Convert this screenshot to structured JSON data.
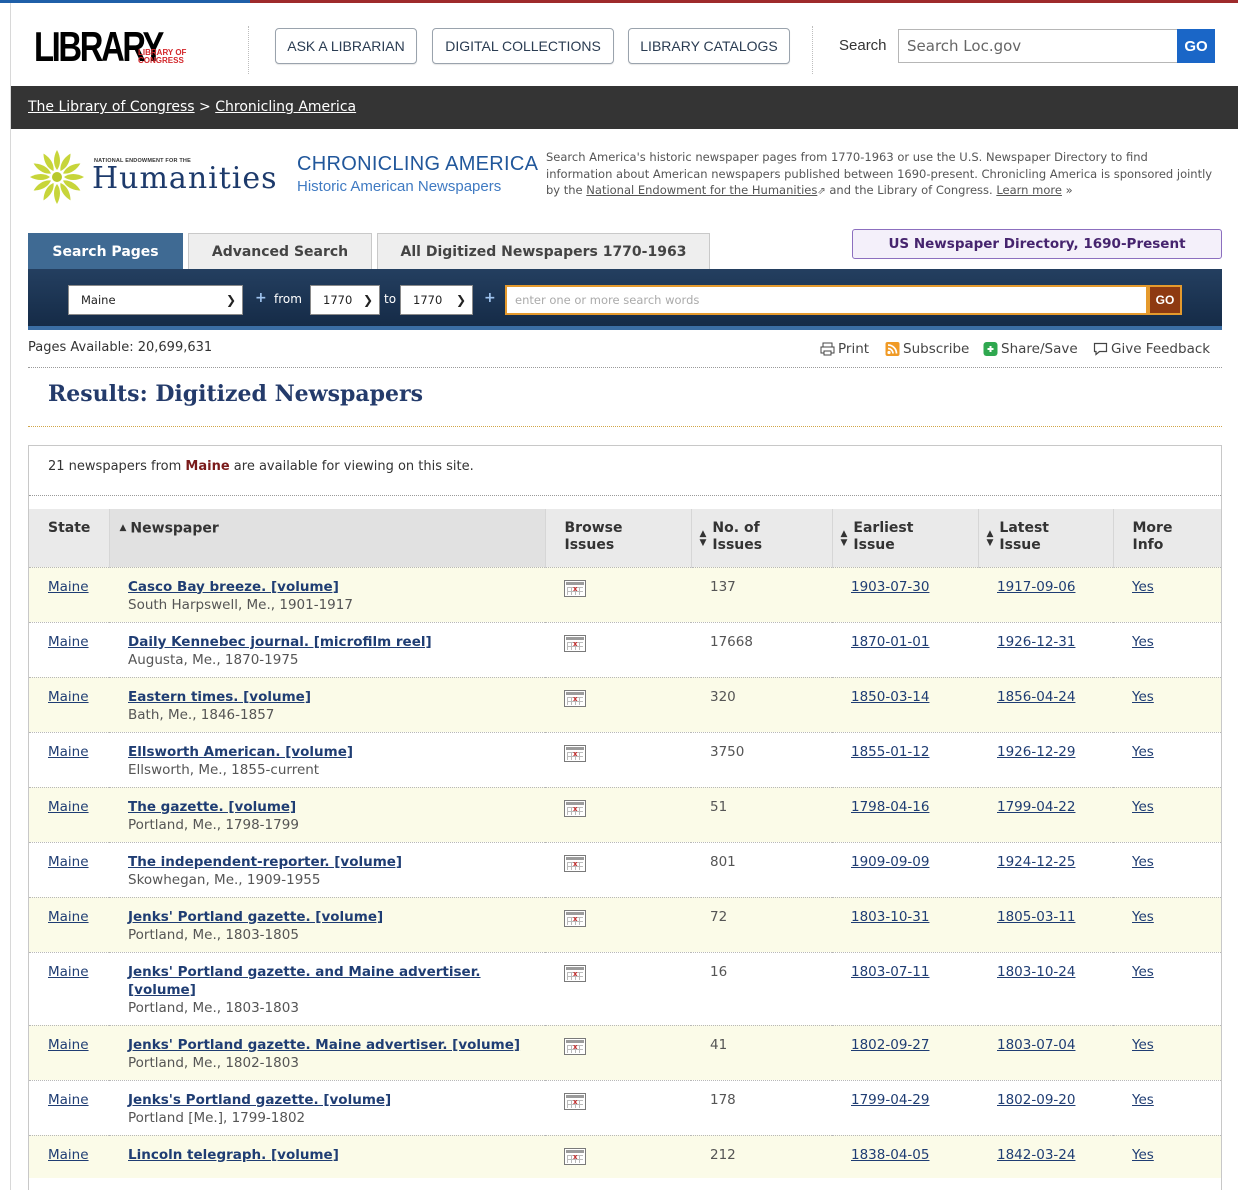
{
  "header": {
    "logo_big": "LIBRARY",
    "logo_small": "LIBRARY OF CONGRESS",
    "buttons": [
      "ASK A LIBRARIAN",
      "DIGITAL COLLECTIONS",
      "LIBRARY CATALOGS"
    ],
    "search_label": "Search",
    "search_placeholder": "Search Loc.gov",
    "go_label": "GO"
  },
  "breadcrumb": {
    "home": "The Library of Congress",
    "separator": ">",
    "current": "Chronicling America"
  },
  "banner": {
    "neh_small": "NATIONAL ENDOWMENT FOR THE",
    "neh_word": "Humanities",
    "title": "CHRONICLING AMERICA",
    "subtitle": "Historic American Newspapers",
    "desc_start": "Search America's historic newspaper pages from 1770-1963 or use the U.S. Newspaper Directory to find information about American newspapers published between 1690-present. Chronicling America is sponsored jointly by the ",
    "desc_link": "National Endowment for the Humanities",
    "desc_mid": " and the Library of Congress. ",
    "desc_more": "Learn more",
    "desc_more_arrow": "»"
  },
  "tabs": [
    {
      "label": "Search Pages",
      "active": true
    },
    {
      "label": "Advanced Search",
      "active": false
    },
    {
      "label": "All Digitized Newspapers 1770-1963",
      "active": false
    }
  ],
  "directory_button": "US Newspaper Directory, 1690-Present",
  "search_bar": {
    "state": "Maine",
    "plus": "+",
    "from_label": "from",
    "from_year": "1770",
    "to_label": "to",
    "to_year": "1770",
    "placeholder": "enter one or more search words",
    "go_label": "GO"
  },
  "meta": {
    "pages_available": "Pages Available: 20,699,631",
    "tools": [
      "Print",
      "Subscribe",
      "Share/Save",
      "Give Feedback"
    ]
  },
  "results": {
    "title": "Results: Digitized Newspapers",
    "count_prefix": "21 newspapers from ",
    "count_state": "Maine",
    "count_suffix": " are available for viewing on this site.",
    "columns": {
      "state": "State",
      "newspaper": "Newspaper",
      "browse_1": "Browse",
      "browse_2": "Issues",
      "num_1": "No. of",
      "num_2": "Issues",
      "earliest_1": "Earliest",
      "earliest_2": "Issue",
      "latest_1": "Latest",
      "latest_2": "Issue",
      "more_1": "More",
      "more_2": "Info"
    },
    "rows": [
      {
        "state": "Maine",
        "title": "Casco Bay breeze. [volume]",
        "place": "South Harpswell, Me., 1901-1917",
        "issues": "137",
        "earliest": "1903-07-30",
        "latest": "1917-09-06",
        "more": "Yes"
      },
      {
        "state": "Maine",
        "title": "Daily Kennebec journal. [microfilm reel]",
        "place": "Augusta, Me., 1870-1975",
        "issues": "17668",
        "earliest": "1870-01-01",
        "latest": "1926-12-31",
        "more": "Yes"
      },
      {
        "state": "Maine",
        "title": "Eastern times. [volume]",
        "place": "Bath, Me., 1846-1857",
        "issues": "320",
        "earliest": "1850-03-14",
        "latest": "1856-04-24",
        "more": "Yes"
      },
      {
        "state": "Maine",
        "title": "Ellsworth American. [volume]",
        "place": "Ellsworth, Me., 1855-current",
        "issues": "3750",
        "earliest": "1855-01-12",
        "latest": "1926-12-29",
        "more": "Yes"
      },
      {
        "state": "Maine",
        "title": "The gazette. [volume]",
        "place": "Portland, Me., 1798-1799",
        "issues": "51",
        "earliest": "1798-04-16",
        "latest": "1799-04-22",
        "more": "Yes"
      },
      {
        "state": "Maine",
        "title": "The independent-reporter. [volume]",
        "place": "Skowhegan, Me., 1909-1955",
        "issues": "801",
        "earliest": "1909-09-09",
        "latest": "1924-12-25",
        "more": "Yes"
      },
      {
        "state": "Maine",
        "title": "Jenks' Portland gazette. [volume]",
        "place": "Portland, Me., 1803-1805",
        "issues": "72",
        "earliest": "1803-10-31",
        "latest": "1805-03-11",
        "more": "Yes"
      },
      {
        "state": "Maine",
        "title": "Jenks' Portland gazette. and Maine advertiser. [volume]",
        "place": "Portland, Me., 1803-1803",
        "issues": "16",
        "earliest": "1803-07-11",
        "latest": "1803-10-24",
        "more": "Yes"
      },
      {
        "state": "Maine",
        "title": "Jenks' Portland gazette. Maine advertiser. [volume]",
        "place": "Portland, Me., 1802-1803",
        "issues": "41",
        "earliest": "1802-09-27",
        "latest": "1803-07-04",
        "more": "Yes"
      },
      {
        "state": "Maine",
        "title": "Jenks's Portland gazette. [volume]",
        "place": "Portland [Me.], 1799-1802",
        "issues": "178",
        "earliest": "1799-04-29",
        "latest": "1802-09-20",
        "more": "Yes"
      },
      {
        "state": "Maine",
        "title": "Lincoln telegraph. [volume]",
        "place": "",
        "issues": "212",
        "earliest": "1838-04-05",
        "latest": "1842-03-24",
        "more": "Yes"
      }
    ]
  }
}
